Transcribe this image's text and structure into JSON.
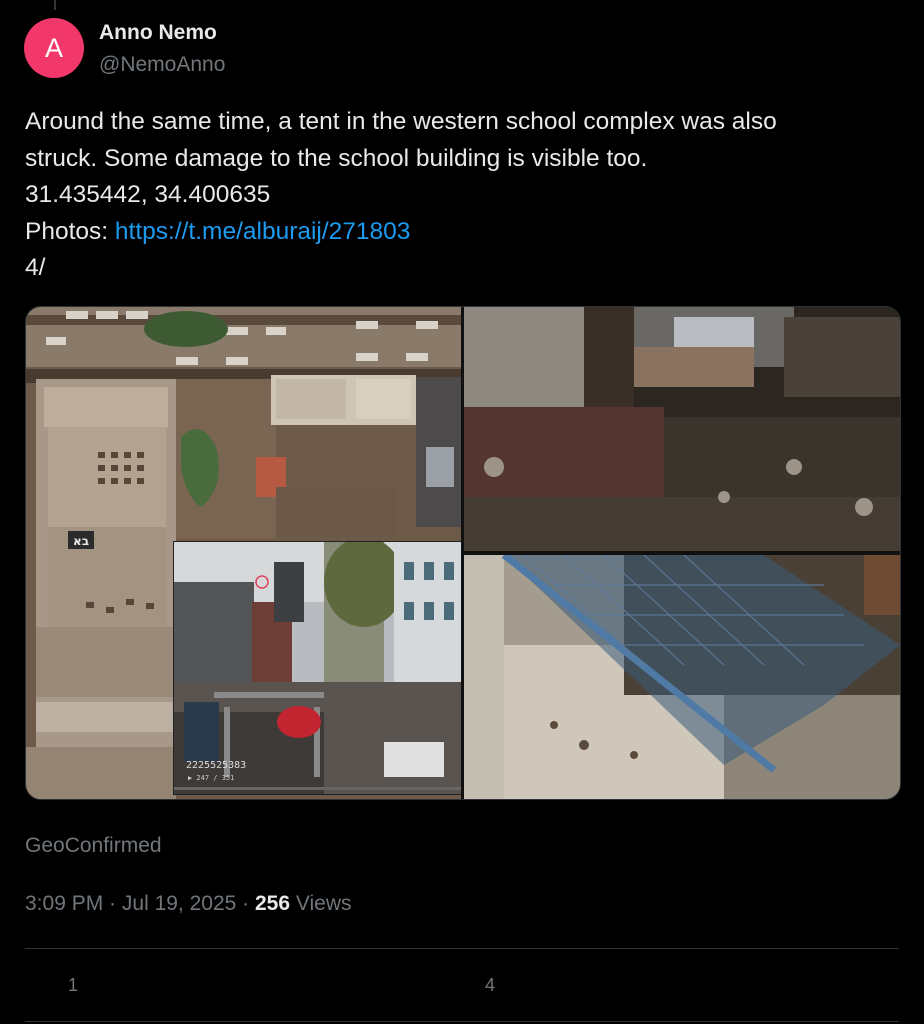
{
  "author": {
    "avatar_letter": "A",
    "avatar_color": "#f2386b",
    "name": "Anno Nemo",
    "handle": "@NemoAnno"
  },
  "tweet": {
    "lines": [
      "Around the same time, a tent in the western school complex was also",
      "struck. Some damage to the school building is visible too.",
      "31.435442, 34.400635"
    ],
    "photos_label": "Photos: ",
    "photos_link": "https://t.me/alburaij/271803",
    "thread_index": "4/"
  },
  "media": {
    "inset_id": "2225525383",
    "inset_sub": "▶ 247 / 351",
    "inset_roof_mark": "בא"
  },
  "source_label": "GeoConfirmed",
  "meta": {
    "time": "3:09 PM",
    "separator": " · ",
    "date": "Jul 19, 2025",
    "views_count": "256",
    "views_label": " Views"
  },
  "actions": {
    "replies": "1",
    "likes": "4"
  },
  "colors": {
    "background": "#000000",
    "text": "#e7e9ea",
    "muted": "#71767b",
    "link": "#1d9bf0",
    "divider": "#2f3336"
  }
}
